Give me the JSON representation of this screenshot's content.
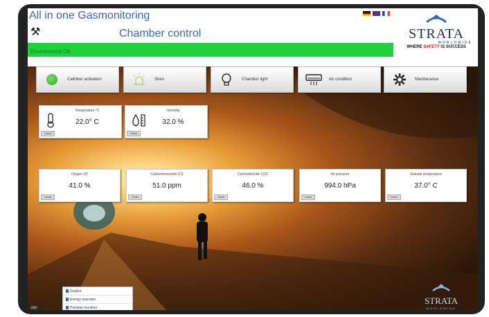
{
  "header": {
    "app_title": "All in one Gasmonitoring",
    "chamber_title": "Chamber control",
    "tools_icon": "tools-icon",
    "flag_colors": [
      "#e8c020",
      "#c0392b",
      "#3355aa"
    ]
  },
  "logo": {
    "name": "STRATA",
    "sub": "WORLDWIDE",
    "tag_a": "WHERE ",
    "tag_b": "SAFETY",
    "tag_c": " IS SUCCESS"
  },
  "status": {
    "text": "Environment OK",
    "color": "#1fd13b"
  },
  "buttons": [
    {
      "label": "Calmber activation",
      "icon": "status-dot-icon"
    },
    {
      "label": "Siren",
      "icon": "siren-icon"
    },
    {
      "label": "Chamber light",
      "icon": "light-bulb-icon"
    },
    {
      "label": "Air condition",
      "icon": "air-condition-icon"
    },
    {
      "label": "Maintanance",
      "icon": "gear-icon"
    }
  ],
  "sensors_top": [
    {
      "caption": "Temperature °C",
      "value": "22.0° C",
      "chart": "Chart",
      "icon": "thermometer-icon"
    },
    {
      "caption": "Humidity",
      "value": "32.0 %",
      "chart": "Chart",
      "icon": "humidity-icon"
    }
  ],
  "sensors_row": [
    {
      "caption": "Oxigen O2",
      "value": "41.0 %",
      "chart": "Chart"
    },
    {
      "caption": "Carbonmonoxide CO",
      "value": "51.0 ppm",
      "chart": "Chart"
    },
    {
      "caption": "Carbondioxide CO2",
      "value": "46.0 %",
      "chart": "Chart"
    },
    {
      "caption": "Air pressure",
      "value": "994.0 hPa",
      "chart": "Chart"
    },
    {
      "caption": "Outside temperature",
      "value": "37.0° C",
      "chart": "Chart"
    }
  ],
  "menu": {
    "items": [
      "Graphs",
      "Energy overview",
      "Portable monitors"
    ]
  },
  "bottom_button": "API",
  "corner_logo": {
    "name": "STRATA",
    "sub": "WORLDWIDE"
  }
}
